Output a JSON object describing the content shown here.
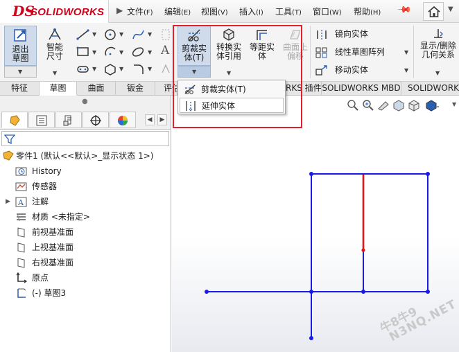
{
  "app": {
    "logo_mark": "DS",
    "logo_text": "SOLIDWORKS"
  },
  "menu": [
    {
      "label": "文件",
      "hotkey": "(F)"
    },
    {
      "label": "编辑",
      "hotkey": "(E)"
    },
    {
      "label": "视图",
      "hotkey": "(V)"
    },
    {
      "label": "插入",
      "hotkey": "(I)"
    },
    {
      "label": "工具",
      "hotkey": "(T)"
    },
    {
      "label": "窗口",
      "hotkey": "(W)"
    },
    {
      "label": "帮助",
      "hotkey": "(H)"
    }
  ],
  "ribbon": {
    "exit_sketch": "退出草图",
    "smart_dimension": "智能尺寸",
    "trim_entities": "剪裁实体(T)",
    "trim_entities_line1": "剪裁实",
    "trim_entities_line2": "体(T)",
    "convert_entities_line1": "转换实",
    "convert_entities_line2": "体引用",
    "offset_entities_line1": "等距实",
    "offset_entities_line2": "体",
    "offset_surface_line1": "曲面上",
    "offset_surface_line2": "偏移",
    "mirror_entities": "镜向实体",
    "linear_pattern": "线性草图阵列",
    "move_entities": "移动实体",
    "display_relations_line1": "显示/删除",
    "display_relations_line2": "几何关系"
  },
  "command_tabs": [
    "特征",
    "草图",
    "曲面",
    "钣金",
    "评估",
    "RKS 插件",
    "SOLIDWORKS MBD",
    "SOLIDWORKS"
  ],
  "dropdown": {
    "items": [
      {
        "label": "剪裁实体(T)",
        "icon": "trim-icon"
      },
      {
        "label": "延伸实体",
        "icon": "extend-icon"
      }
    ]
  },
  "tree": {
    "root": "零件1 (默认<<默认>_显示状态 1>)",
    "items": [
      {
        "label": "History",
        "icon": "history-icon"
      },
      {
        "label": "传感器",
        "icon": "sensor-icon"
      },
      {
        "label": "注解",
        "icon": "annotation-icon"
      },
      {
        "label": "材质 <未指定>",
        "icon": "material-icon"
      },
      {
        "label": "前视基准面",
        "icon": "plane-icon"
      },
      {
        "label": "上视基准面",
        "icon": "plane-icon"
      },
      {
        "label": "右视基准面",
        "icon": "plane-icon"
      },
      {
        "label": "原点",
        "icon": "origin-icon"
      },
      {
        "label": "(-) 草图3",
        "icon": "sketch-icon"
      }
    ]
  },
  "watermark": {
    "line1": "牛8牛9",
    "line2": "N3NQ.NET"
  },
  "colors": {
    "brand_red": "#d0021b",
    "highlight_red": "#e0202a",
    "sketch_blue": "#1a1ae6",
    "selected_red": "#e01818"
  }
}
